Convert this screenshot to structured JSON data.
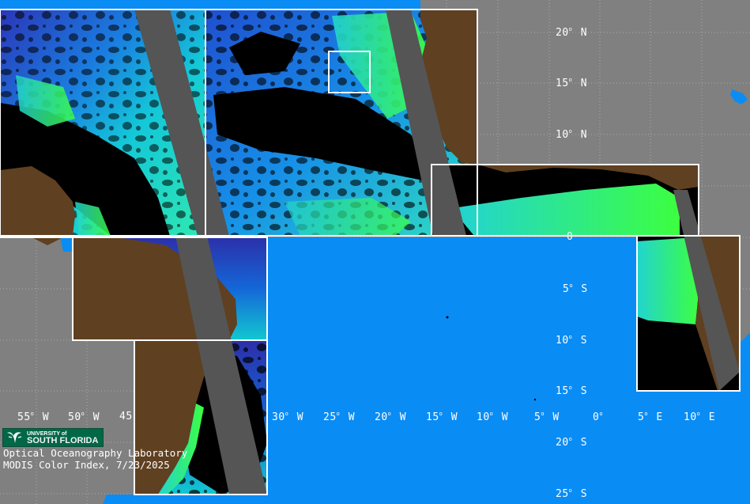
{
  "lat_labels": [
    {
      "deg": "20",
      "hem": "N"
    },
    {
      "deg": "15",
      "hem": "N"
    },
    {
      "deg": "10",
      "hem": "N"
    },
    {
      "deg": "0",
      "hem": ""
    },
    {
      "deg": "5",
      "hem": "S"
    },
    {
      "deg": "10",
      "hem": "S"
    },
    {
      "deg": "15",
      "hem": "S"
    },
    {
      "deg": "20",
      "hem": "S"
    },
    {
      "deg": "25",
      "hem": "S"
    }
  ],
  "lon_labels": [
    {
      "deg": "55",
      "hem": "W"
    },
    {
      "deg": "50",
      "hem": "W"
    },
    {
      "deg": "45",
      "hem": ""
    },
    {
      "deg": "30",
      "hem": "W"
    },
    {
      "deg": "25",
      "hem": "W"
    },
    {
      "deg": "20",
      "hem": "W"
    },
    {
      "deg": "15",
      "hem": "W"
    },
    {
      "deg": "10",
      "hem": "W"
    },
    {
      "deg": "5",
      "hem": "W"
    },
    {
      "deg": "0",
      "hem": ""
    },
    {
      "deg": "5",
      "hem": "E"
    },
    {
      "deg": "10",
      "hem": "E"
    }
  ],
  "logo": {
    "top_text": "UNIVERSITY of",
    "name": "SOUTH FLORIDA"
  },
  "credit": {
    "lab": "Optical Oceanography Laboratory",
    "product": "MODIS Color Index, 7/23/2025"
  },
  "colors": {
    "land": "#5f4021",
    "ocean": "#0a8cf5",
    "background": "#808080",
    "swath_gap": "#555555",
    "no_data": "#000000",
    "box_outline": "#ffffff"
  }
}
